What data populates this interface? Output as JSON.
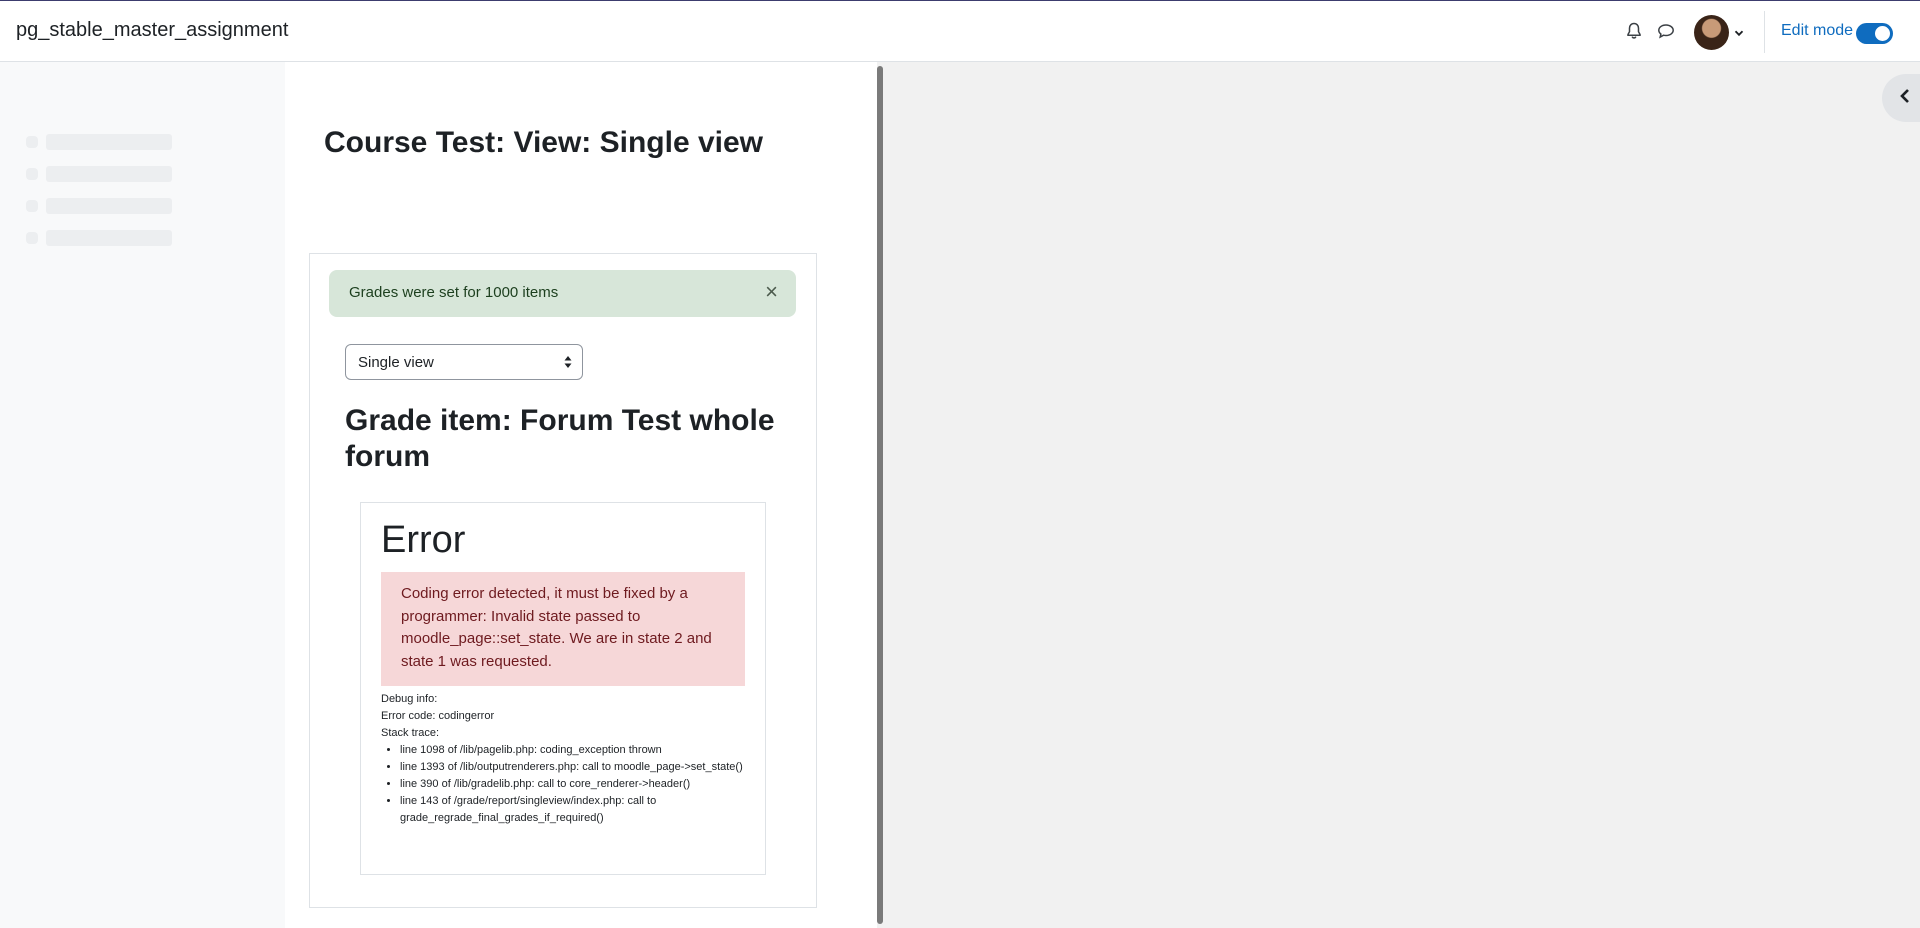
{
  "header": {
    "site_name": "pg_stable_master_assignment",
    "edit_mode_label": "Edit mode"
  },
  "page": {
    "title": "Course Test: View: Single view"
  },
  "notification": {
    "message": "Grades were set for 1000 items",
    "close_glyph": "×"
  },
  "view_select": {
    "selected": "Single view"
  },
  "grade_item": {
    "heading": "Grade item: Forum Test whole forum"
  },
  "error": {
    "title": "Error",
    "message": "Coding error detected, it must be fixed by a programmer: Invalid state passed to moodle_page::set_state. We are in state 2 and state 1 was requested.",
    "debug_info_label": "Debug info:",
    "error_code_line": "Error code: codingerror",
    "stack_trace_label": "Stack trace:",
    "stack_trace": [
      "line 1098 of /lib/pagelib.php: coding_exception thrown",
      "line 1393 of /lib/outputrenderers.php: call to moodle_page->set_state()",
      "line 390 of /lib/gradelib.php: call to core_renderer->header()",
      "line 143 of /grade/report/singleview/index.php: call to grade_regrade_final_grades_if_required()"
    ]
  },
  "icons": {
    "notifications": "bell-icon",
    "messages": "chat-bubble-icon",
    "avatar_menu": "chevron-down-icon",
    "close": "close-icon",
    "select_arrows": "sort-arrows-icon",
    "right_drawer": "chevron-left-icon"
  },
  "colors": {
    "accent": "#0f6cbf",
    "success_bg": "#d7e6d9",
    "error_bg": "#f6d7d8",
    "error_text": "#6e1a1f"
  }
}
